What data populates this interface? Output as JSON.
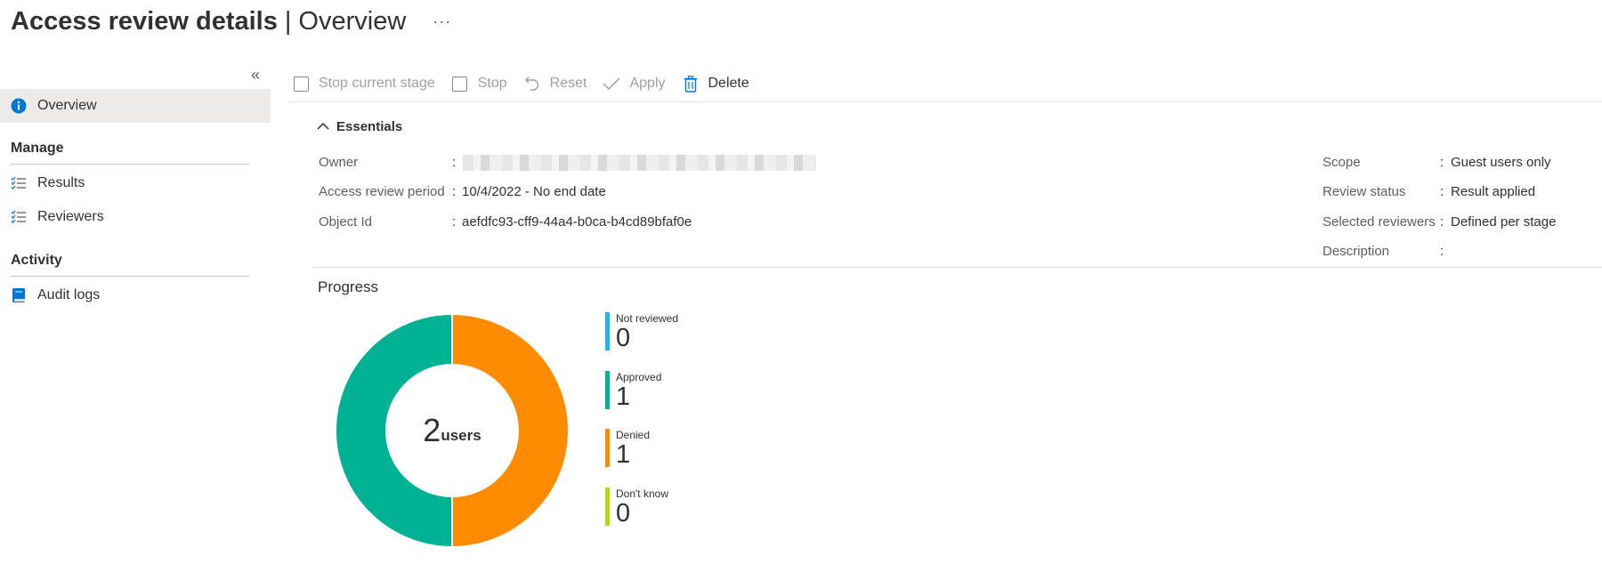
{
  "header": {
    "title": "Access review details",
    "separator": "|",
    "subtitle": "Overview",
    "more": "···"
  },
  "sidebar": {
    "collapse": "«",
    "items": [
      {
        "label": "Overview",
        "icon": "info-icon"
      },
      {
        "label": "Results",
        "icon": "checklist-icon"
      },
      {
        "label": "Reviewers",
        "icon": "checklist-icon"
      },
      {
        "label": "Audit logs",
        "icon": "book-icon"
      }
    ],
    "sections": [
      "Manage",
      "Activity"
    ]
  },
  "toolbar": {
    "stop_current_stage": "Stop current stage",
    "stop": "Stop",
    "reset": "Reset",
    "apply": "Apply",
    "delete": "Delete"
  },
  "essentials": {
    "header": "Essentials",
    "left": [
      {
        "label": "Owner",
        "value": ""
      },
      {
        "label": "Access review period",
        "value": "10/4/2022 - No end date"
      },
      {
        "label": "Object Id",
        "value": "aefdfc93-cff9-44a4-b0ca-b4cd89bfaf0e"
      }
    ],
    "right": [
      {
        "label": "Scope",
        "value": "Guest users only"
      },
      {
        "label": "Review status",
        "value": "Result applied"
      },
      {
        "label": "Selected reviewers",
        "value": "Defined per stage"
      },
      {
        "label": "Description",
        "value": ""
      }
    ],
    "colon": ":"
  },
  "progress": {
    "title": "Progress",
    "total": "2",
    "unit": "users",
    "legend": [
      {
        "label": "Not reviewed",
        "value": "0",
        "color": "#1cb6e8"
      },
      {
        "label": "Approved",
        "value": "1",
        "color": "#00b294"
      },
      {
        "label": "Denied",
        "value": "1",
        "color": "#ff8c00"
      },
      {
        "label": "Don't know",
        "value": "0",
        "color": "#bad80a"
      }
    ]
  },
  "colors": {
    "accent": "#0078d4",
    "selected_bg": "#edebe9",
    "approved": "#00b294",
    "denied": "#ff8c00"
  }
}
